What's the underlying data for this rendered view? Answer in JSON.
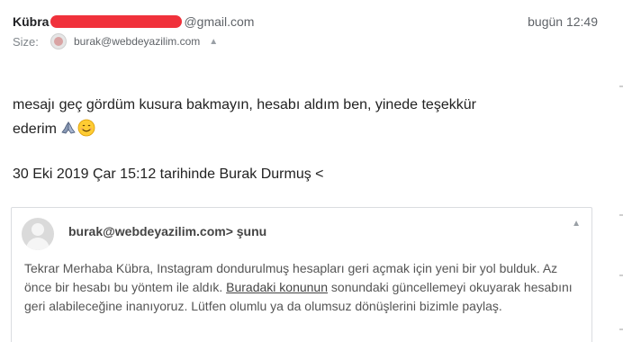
{
  "header": {
    "sender_name": "Kübra",
    "sender_domain": "@gmail.com",
    "timestamp": "bugün 12:49",
    "to_label": "Size:",
    "to_address": "burak@webdeyazilim.com",
    "to_chevron": "^"
  },
  "message": {
    "line1": "mesajı geç gördüm kusura bakmayın, hesabı aldım ben, yinede teşekkür",
    "line2": "ederim",
    "emoji_1": "folded-hands-icon",
    "emoji_2": "smiling-face-icon"
  },
  "reply_header": "30 Eki 2019 Çar 15:12 tarihinde Burak Durmuş <",
  "quote": {
    "sender": "burak@webdeyazilim.com> şunu",
    "chevron": "^",
    "text_before_link": "Tekrar Merhaba Kübra, Instagram dondurulmuş hesapları geri açmak için yeni bir yol bulduk. Az önce bir hesabı bu yöntem ile aldık. ",
    "link_text": "Buradaki konunun",
    "text_after_link": " sonundaki güncellemeyi okuyarak hesabını geri alabileceğine inanıyoruz. Lütfen olumlu ya da olumsuz dönüşlerini bizimle paylaş."
  },
  "colors": {
    "redaction": "#f0313b",
    "text_primary": "#222222",
    "text_secondary": "#5f6368",
    "border": "#dadce0"
  }
}
